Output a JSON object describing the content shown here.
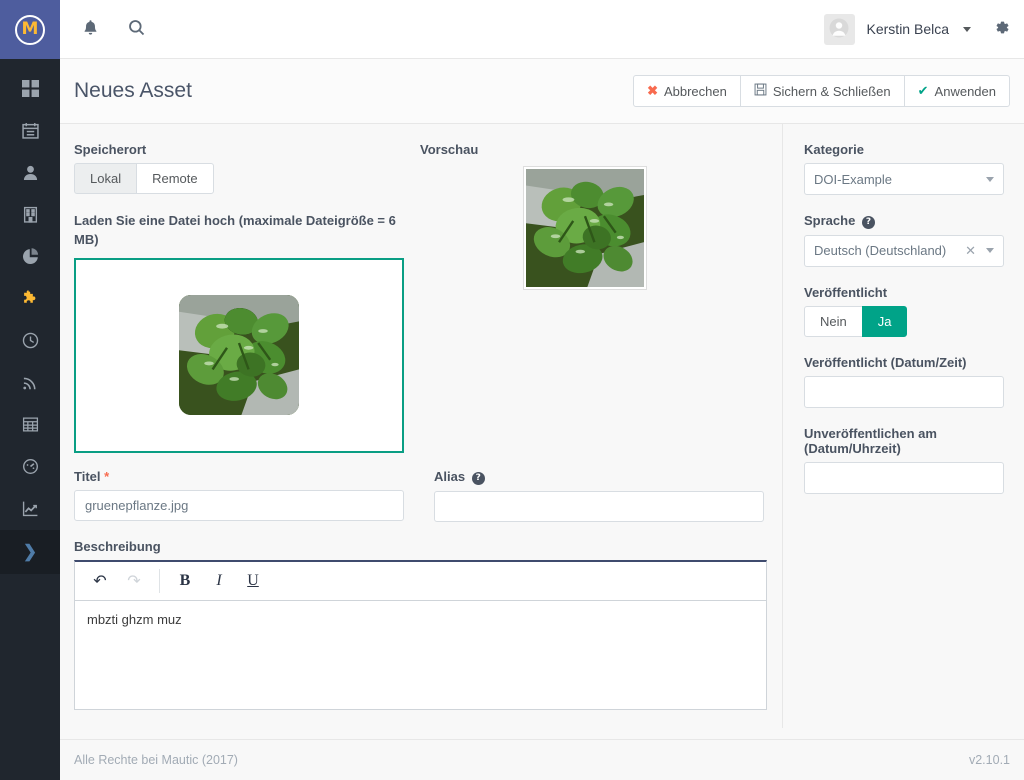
{
  "brand": {
    "logo_letter": "M",
    "logo_bg": "#4e5d9e",
    "logo_color": "#fdb933"
  },
  "topbar": {
    "notifications_icon": "bell-icon",
    "search_icon": "search-icon",
    "user_name": "Kerstin Belca",
    "settings_icon": "gear-icon",
    "avatar_icon": "user-avatar-icon"
  },
  "sidebar": {
    "items": [
      {
        "name": "dashboard",
        "icon": "grid-icon"
      },
      {
        "name": "calendar",
        "icon": "calendar-icon"
      },
      {
        "name": "contacts",
        "icon": "person-icon"
      },
      {
        "name": "companies",
        "icon": "building-icon"
      },
      {
        "name": "reports",
        "icon": "pie-chart-icon"
      },
      {
        "name": "components",
        "icon": "puzzle-icon",
        "active": true
      },
      {
        "name": "points",
        "icon": "clock-icon"
      },
      {
        "name": "stages",
        "icon": "rss-icon"
      },
      {
        "name": "forms",
        "icon": "table-icon"
      },
      {
        "name": "dashboards",
        "icon": "gauge-icon"
      },
      {
        "name": "analytics",
        "icon": "line-chart-icon"
      }
    ],
    "expand_icon": "chevron-right-icon"
  },
  "header": {
    "title": "Neues Asset",
    "buttons": [
      {
        "label": "Abbrechen",
        "icon": "close-x-icon",
        "icon_char": "✖",
        "icon_color": "#f86b4f"
      },
      {
        "label": "Sichern & Schließen",
        "icon": "save-disk-icon",
        "icon_char": "Ὃe",
        "icon_color": "#6b7884"
      },
      {
        "label": "Anwenden",
        "icon": "check-icon",
        "icon_char": "✔",
        "icon_color": "#00a388"
      }
    ]
  },
  "form": {
    "storage_label": "Speicherort",
    "storage_options": [
      {
        "label": "Lokal",
        "selected": true
      },
      {
        "label": "Remote",
        "selected": false
      }
    ],
    "upload_note": "Laden Sie eine Datei hoch (maximale Dateigröße = 6 MB)",
    "dropzone_border_color": "#0a9e84",
    "preview_label": "Vorschau",
    "title_label": "Titel",
    "title_required_mark": "*",
    "title_value": "gruenepflanze.jpg",
    "alias_label": "Alias",
    "alias_help_char": "?",
    "alias_value": "",
    "description_label": "Beschreibung",
    "editor": {
      "undo_icon": "undo-icon",
      "undo_char": "↶",
      "redo_icon": "redo-icon",
      "redo_char": "↷",
      "bold_label": "B",
      "italic_label": "I",
      "underline_label": "U",
      "body_text": "mbzti ghzm muz"
    }
  },
  "panel": {
    "category_label": "Kategorie",
    "category_value": "DOI-Example",
    "language_label": "Sprache",
    "language_help_char": "?",
    "language_value": "Deutsch (Deutschland)",
    "language_clear_char": "✕",
    "published_label": "Veröffentlicht",
    "published_options": [
      {
        "label": "Nein",
        "selected": false
      },
      {
        "label": "Ja",
        "selected": true
      }
    ],
    "published_accent": "#00a388",
    "publish_up_label": "Veröffentlicht (Datum/Zeit)",
    "publish_up_value": "",
    "publish_down_label": "Unveröffentlichen am (Datum/Uhrzeit)",
    "publish_down_value": ""
  },
  "footer": {
    "copyright": "Alle Rechte bei Mautic (2017)",
    "version": "v2.10.1"
  }
}
